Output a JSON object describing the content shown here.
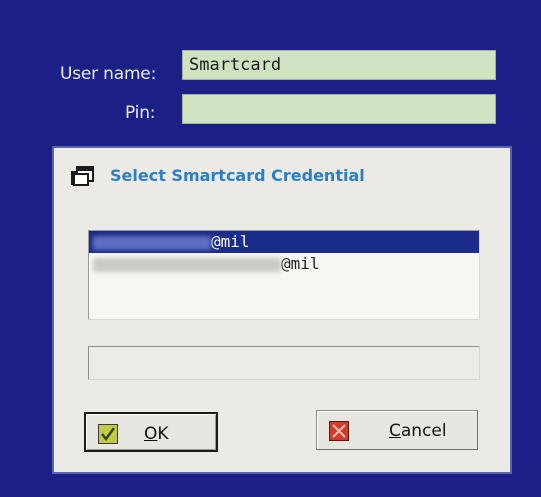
{
  "login": {
    "username_label": "User name:",
    "username_value": "Smartcard",
    "pin_label": "Pin:",
    "pin_value": ""
  },
  "dialog": {
    "title": "Select Smartcard Credential",
    "icon": "window-stack-icon",
    "credentials": [
      {
        "suffix": "@mil",
        "selected": true,
        "identifier_redacted": true
      },
      {
        "suffix": "@mil",
        "selected": false,
        "identifier_redacted": true
      }
    ],
    "status_text": "",
    "ok_label": "OK",
    "ok_icon": "green-check-icon",
    "cancel_label": "Cancel",
    "cancel_icon": "red-x-icon"
  },
  "colors": {
    "background": "#1c1f86",
    "field_bg": "#cfe3c0",
    "dialog_bg": "#ebeae4",
    "title_color": "#2c7fc5",
    "selection_bg": "#1c2c8a"
  }
}
